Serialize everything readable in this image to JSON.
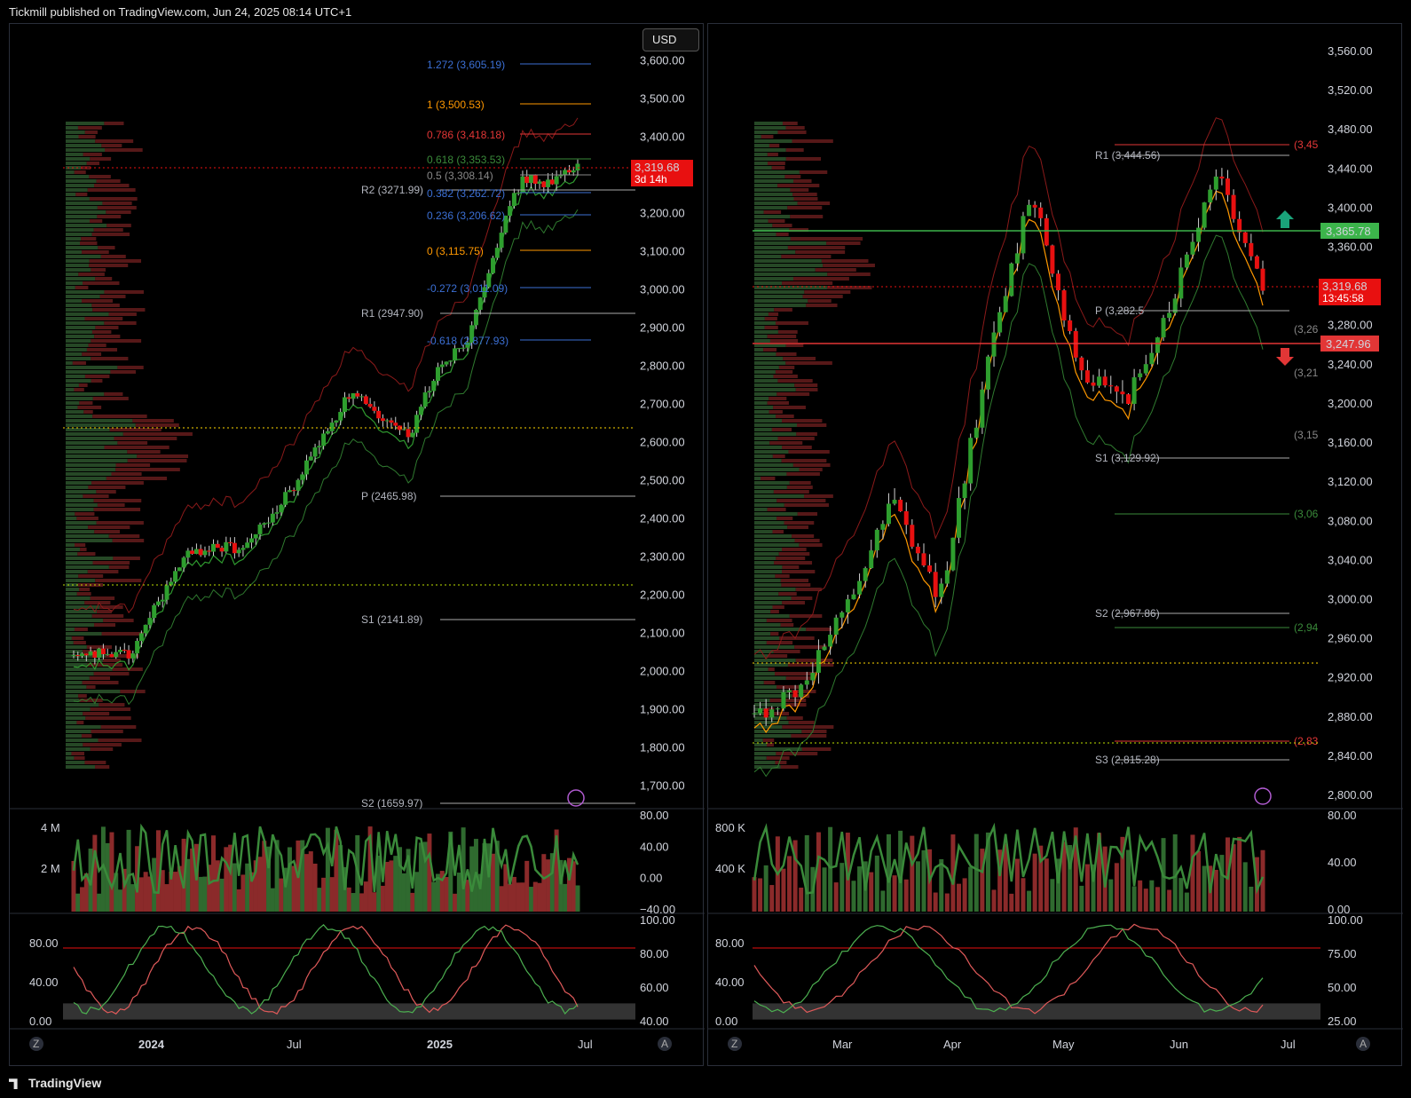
{
  "header": {
    "publisher": "Tickmill published on TradingView.com, Jun 24, 2025 08:14 UTC+1"
  },
  "footer": {
    "brand": "TradingView"
  },
  "left": {
    "currency": "USD",
    "price_axis": [
      "3,600.00",
      "3,500.00",
      "3,400.00",
      "3,300.00",
      "3,200.00",
      "3,100.00",
      "3,000.00",
      "2,900.00",
      "2,800.00",
      "2,700.00",
      "2,600.00",
      "2,500.00",
      "2,400.00",
      "2,300.00",
      "2,200.00",
      "2,100.00",
      "2,000.00",
      "1,900.00",
      "1,800.00",
      "1,700.00"
    ],
    "last_price": "3,319.68",
    "countdown": "3d 14h",
    "fib_labels": [
      "1.272 (3,605.19)",
      "1 (3,500.53)",
      "0.786 (3,418.18)",
      "0.618 (3,353.53)",
      "0.5 (3,308.14)",
      "0.382 (3,262.72)",
      "0.236 (3,206.62)",
      "0 (3,115.75)",
      "-0.272 (3,011.09)",
      "-0.618 (2,877.93)"
    ],
    "pivot_labels": [
      "R2 (3271.99)",
      "R1 (2947.90)",
      "P (2465.98)",
      "S1 (2141.89)",
      "S2 (1659.97)"
    ],
    "volume_axis": [
      "4 M",
      "2 M"
    ],
    "volume_osc_axis": [
      "80.00",
      "40.00",
      "0.00",
      "−40.00"
    ],
    "stoch_axis_left": [
      "80.00",
      "40.00",
      "0.00"
    ],
    "stoch_axis_right": [
      "100.00",
      "80.00",
      "60.00",
      "40.00"
    ],
    "time_axis": [
      "2024",
      "Jul",
      "2025",
      "Jul"
    ],
    "corner_z": "Z",
    "corner_a": "A"
  },
  "right": {
    "price_axis": [
      "3,560.00",
      "3,520.00",
      "3,480.00",
      "3,440.00",
      "3,400.00",
      "3,360.00",
      "3,320.00",
      "3,280.00",
      "3,240.00",
      "3,200.00",
      "3,160.00",
      "3,120.00",
      "3,080.00",
      "3,040.00",
      "3,000.00",
      "2,960.00",
      "2,920.00",
      "2,880.00",
      "2,840.00",
      "2,800.00"
    ],
    "level_green": "3,365.78",
    "last_price": "3,319.68",
    "countdown": "13:45:58",
    "level_red": "3,247.96",
    "pivot_labels": [
      "R1 (3,444.56)",
      "P (3,282.5",
      "S1 (3,129.92)",
      "S2 (2,967.86)",
      "S3 (2,815.28)"
    ],
    "cut_labels": [
      "(3,45",
      "(3,26",
      "(3,21",
      "(3,15",
      "(3,06",
      "(2,94",
      "(2,83"
    ],
    "volume_axis": [
      "800 K",
      "400 K"
    ],
    "volume_osc_axis": [
      "80.00",
      "40.00",
      "0.00"
    ],
    "stoch_axis_left": [
      "80.00",
      "40.00",
      "0.00"
    ],
    "stoch_axis_right": [
      "100.00",
      "75.00",
      "50.00",
      "25.00"
    ],
    "time_axis": [
      "Mar",
      "Apr",
      "May",
      "Jun",
      "Jul"
    ],
    "corner_z": "Z",
    "corner_a": "A"
  },
  "colors": {
    "up": "#2e9e2e",
    "down": "#e81010",
    "bg": "#000000",
    "axis_text": "#d1d4dc",
    "green_level": "#3cb44b",
    "red_level": "#e23636",
    "orange": "#ff9800"
  },
  "chart_data": [
    {
      "type": "line",
      "title": "",
      "x": [
        "2023-12",
        "2024-01",
        "2024-02",
        "2024-03",
        "2024-04",
        "2024-05",
        "2024-06",
        "2024-07",
        "2024-08",
        "2024-09",
        "2024-10",
        "2024-11",
        "2024-12",
        "2025-01",
        "2025-02",
        "2025-03",
        "2025-04",
        "2025-05",
        "2025-06"
      ],
      "series": [
        {
          "values": [
            2030,
            2050,
            2040,
            2180,
            2300,
            2330,
            2320,
            2400,
            2500,
            2630,
            2740,
            2650,
            2620,
            2800,
            2860,
            3100,
            3290,
            3280,
            3320
          ]
        }
      ],
      "ylim": [
        1650,
        3650
      ],
      "grid": false
    },
    {
      "type": "line",
      "title": "",
      "x": [
        "2025-02-17",
        "2025-03-01",
        "2025-03-15",
        "2025-04-01",
        "2025-04-08",
        "2025-04-15",
        "2025-04-22",
        "2025-05-01",
        "2025-05-15",
        "2025-06-01",
        "2025-06-13",
        "2025-06-24"
      ],
      "series": [
        {
          "values": [
            2880,
            2910,
            2990,
            3100,
            3000,
            3230,
            3420,
            3240,
            3200,
            3300,
            3440,
            3320
          ]
        }
      ],
      "ylim": [
        2790,
        3570
      ],
      "grid": false
    }
  ]
}
